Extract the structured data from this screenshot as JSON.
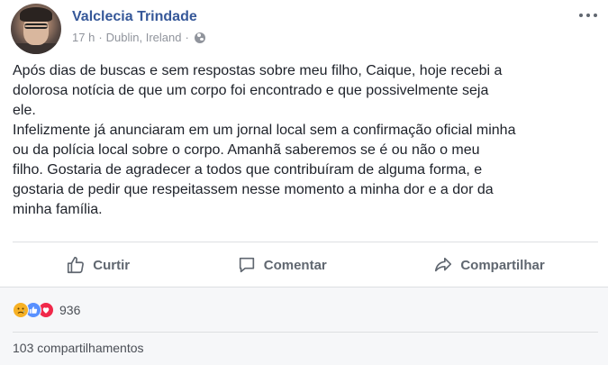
{
  "post": {
    "author": "Valclecia Trindade",
    "time": "17 h",
    "separator": "·",
    "location": "Dublin, Ireland",
    "separator2": "·",
    "paragraph1": "Após dias de buscas e sem respostas sobre meu filho, Caique, hoje recebi a\ndolorosa notícia de que um corpo foi encontrado e que possivelmente seja\nele.",
    "paragraph2": "Infelizmente já anunciaram em um jornal local sem a confirmação oficial minha\nou da polícia local sobre o corpo. Amanhã saberemos se é ou não o meu\nfilho. Gostaria de agradecer a todos que contribuíram de alguma forma, e\ngostaria de pedir que respeitassem nesse momento a minha dor e a dor da\nminha família."
  },
  "actions": {
    "like_label": "Curtir",
    "comment_label": "Comentar",
    "share_label": "Compartilhar"
  },
  "footer": {
    "reaction_count": "936",
    "shares_text": "103 compartilhamentos"
  },
  "icons": {
    "globe": "globe-icon",
    "more": "more-options-icon",
    "like": "thumbs-up-icon",
    "comment": "speech-bubble-icon",
    "share": "share-arrow-icon",
    "reaction_sad": "sad-reaction-icon",
    "reaction_like": "like-reaction-icon",
    "reaction_love": "love-reaction-icon"
  },
  "colors": {
    "author_link": "#365899",
    "meta_gray": "#90949c",
    "action_gray": "#606770",
    "like_blue": "#5890ff",
    "love_red": "#f0284a",
    "sad_yellow": "#f7b125"
  }
}
